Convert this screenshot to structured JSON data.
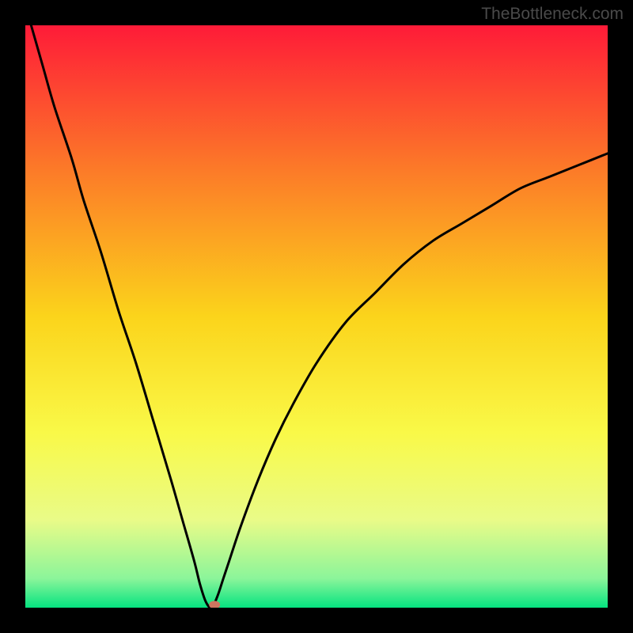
{
  "watermark": "TheBottleneck.com",
  "chart_data": {
    "type": "line",
    "title": "",
    "xlabel": "",
    "ylabel": "",
    "xlim": [
      0,
      100
    ],
    "ylim": [
      0,
      100
    ],
    "grid": false,
    "legend": false,
    "series": [
      {
        "name": "curve",
        "x": [
          1,
          3,
          5,
          8,
          10,
          13,
          16,
          19,
          22,
          25,
          27,
          29,
          30,
          31,
          32,
          33,
          34,
          35,
          37,
          40,
          43,
          46,
          50,
          55,
          60,
          65,
          70,
          75,
          80,
          85,
          90,
          95,
          100
        ],
        "values": [
          100,
          93,
          86,
          77,
          70,
          61,
          51,
          42,
          32,
          22,
          15,
          8,
          4,
          1,
          0,
          2,
          5,
          8,
          14,
          22,
          29,
          35,
          42,
          49,
          54,
          59,
          63,
          66,
          69,
          72,
          74,
          76,
          78
        ]
      }
    ],
    "marker": {
      "x": 32.5,
      "y": 0.5,
      "color": "#cf755f"
    },
    "background_gradient": {
      "stops": [
        {
          "pct": 0,
          "color": "#fe1b38"
        },
        {
          "pct": 25,
          "color": "#fc7b28"
        },
        {
          "pct": 50,
          "color": "#fbd41b"
        },
        {
          "pct": 70,
          "color": "#f9f948"
        },
        {
          "pct": 85,
          "color": "#e9fb88"
        },
        {
          "pct": 95,
          "color": "#8bf59a"
        },
        {
          "pct": 100,
          "color": "#05e380"
        }
      ]
    },
    "frame_color": "#000000"
  }
}
